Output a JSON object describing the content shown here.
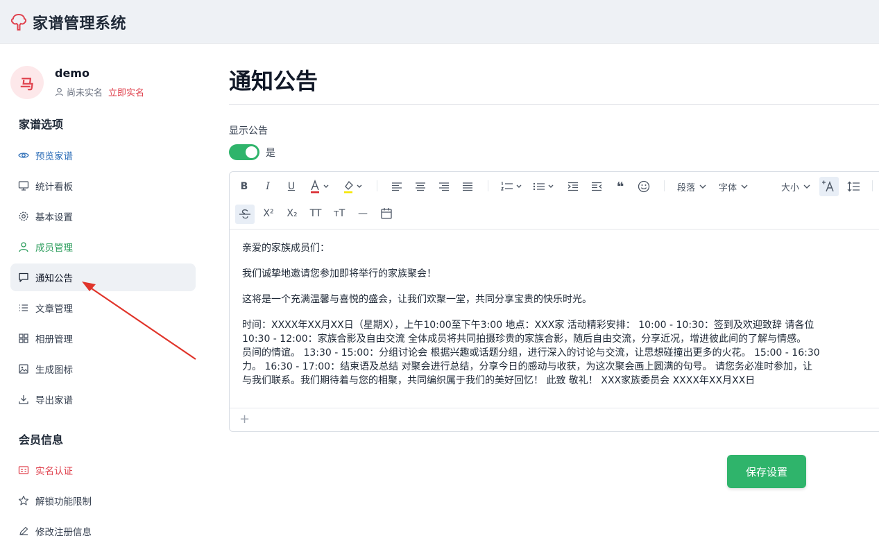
{
  "app": {
    "title": "家谱管理系统"
  },
  "user": {
    "avatar_char": "马",
    "name": "demo",
    "verify_status": "尚未实名",
    "verify_link": "立即实名"
  },
  "sidebar": {
    "section1": "家谱选项",
    "items1": [
      {
        "label": "预览家谱",
        "icon": "eye-icon"
      },
      {
        "label": "统计看板",
        "icon": "monitor-icon"
      },
      {
        "label": "基本设置",
        "icon": "gear-icon"
      },
      {
        "label": "成员管理",
        "icon": "user-icon"
      },
      {
        "label": "通知公告",
        "icon": "message-icon"
      },
      {
        "label": "文章管理",
        "icon": "list-icon"
      },
      {
        "label": "相册管理",
        "icon": "grid-icon"
      },
      {
        "label": "生成图标",
        "icon": "image-icon"
      },
      {
        "label": "导出家谱",
        "icon": "download-icon"
      }
    ],
    "section2": "会员信息",
    "items2": [
      {
        "label": "实名认证",
        "icon": "id-card-icon"
      },
      {
        "label": "解锁功能限制",
        "icon": "star-icon"
      },
      {
        "label": "修改注册信息",
        "icon": "edit-icon"
      }
    ]
  },
  "main": {
    "page_title": "通知公告",
    "show_label": "显示公告",
    "toggle_text": "是",
    "save_label": "保存设置"
  },
  "toolbar": {
    "bold": "B",
    "italic": "I",
    "underline": "U",
    "text_color": "A",
    "quote": "❝",
    "paragraph": "段落",
    "font": "字体",
    "size": "大小",
    "superscript": "X²",
    "subscript": "X₂",
    "tt_upper": "TT",
    "tt_mixed": "ᴛT",
    "hr": "—"
  },
  "content": {
    "p1": "亲爱的家族成员们：",
    "p2": " 我们诚挚地邀请您参加即将举行的家族聚会！",
    "p3": "这将是一个充满温馨与喜悦的盛会，让我们欢聚一堂，共同分享宝贵的快乐时光。",
    "l1": " 时间：XXXX年XX月XX日（星期X），上午10:00至下午3:00 地点：XXX家 活动精彩安排： 10:00 - 10:30：签到及欢迎致辞 请各位",
    "l2": "10:30 - 12:00：家族合影及自由交流 全体成员将共同拍摄珍贵的家族合影，随后自由交流，分享近况，增进彼此间的了解与情感。",
    "l3": "员间的情谊。 13:30 - 15:00：分组讨论会 根据兴趣或话题分组，进行深入的讨论与交流，让思想碰撞出更多的火花。 15:00 - 16:30",
    "l4": "力。 16:30 - 17:00：结束语及总结 对聚会进行总结，分享今日的感动与收获，为这次聚会画上圆满的句号。 请您务必准时参加，让",
    "l5": "与我们联系。我们期待着与您的相聚，共同编织属于我们的美好回忆！ 此致 敬礼！ XXX家族委员会 XXXX年XX月XX日"
  },
  "colors": {
    "accent_green": "#2fb46b",
    "accent_red": "#e0434f",
    "accent_blue": "#2f6fb8",
    "arrow_red": "#e0342a"
  }
}
